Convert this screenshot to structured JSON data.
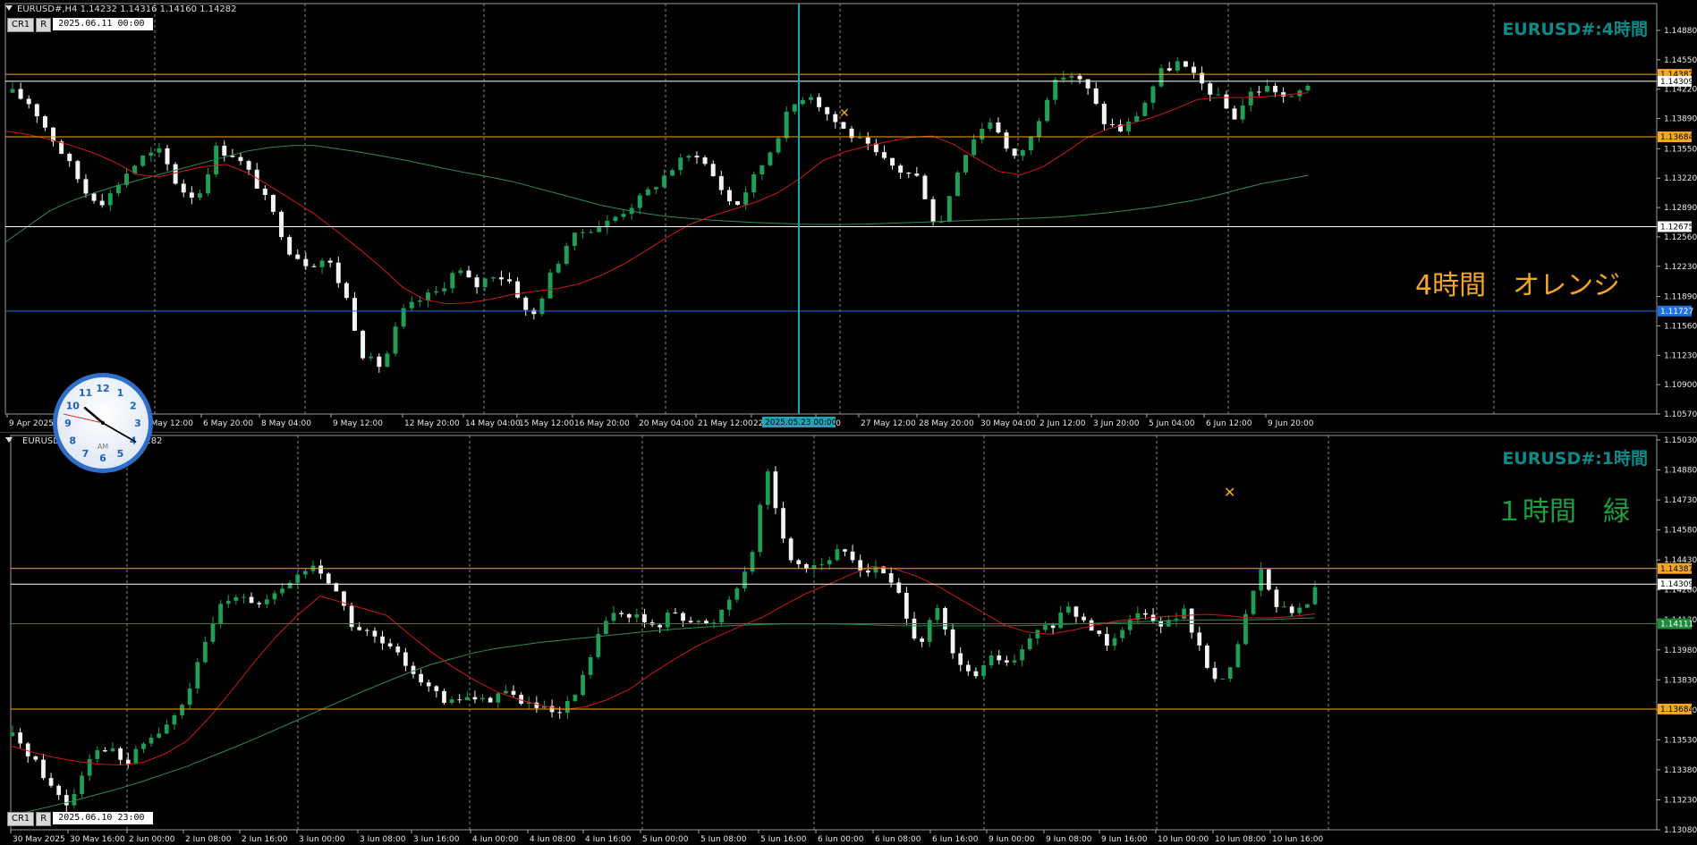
{
  "top_chart": {
    "header": "EURUSD#,H4  1.14232 1.14316 1.14160 1.14282",
    "ctrl_cr": "CR1",
    "ctrl_r": "R",
    "ctrl_date": "2025.06.11 00:00",
    "title": "EURUSD#:4時間",
    "note": "4時間　オレンジ",
    "note_color": "#f5a623",
    "y_ticks": [
      "1.14880",
      "1.14550",
      "1.14220",
      "1.13890",
      "1.13550",
      "1.13220",
      "1.12890",
      "1.12560",
      "1.12230",
      "1.11890",
      "1.11560",
      "1.11230",
      "1.10900",
      "1.10570"
    ],
    "x_ticks": [
      "9 Apr 2025",
      "5 May 12:00",
      "6 May 20:00",
      "8 May 04:00",
      "9 May 12:00",
      "12 May 20:00",
      "14 May 04:00",
      "15 May 12:00",
      "16 May 20:00",
      "20 May 04:00",
      "21 May 12:00",
      "22 M",
      "04:00",
      "27 May 12:00",
      "28 May 20:00",
      "30 May 04:00",
      "2 Jun 12:00",
      "3 Jun 20:00",
      "5 Jun 04:00",
      "6 Jun 12:00",
      "9 Jun 20:00"
    ],
    "x_ticks_partial": [
      "00"
    ],
    "crosshair_label": "2025.05.23 00:00",
    "price_lines": [
      {
        "label": "1.14387",
        "color": "#f5a623"
      },
      {
        "label": "1.14309",
        "color": "#ffffff"
      },
      {
        "label": "1.13684",
        "color": "#f5a623"
      },
      {
        "label": "1.12675",
        "color": "#ffffff"
      },
      {
        "label": "1.11727",
        "color": "#1e6fe0"
      }
    ]
  },
  "bottom_chart": {
    "header": "EURUSD#,H1  1.14185 1.14282",
    "ctrl_cr": "CR1",
    "ctrl_r": "R",
    "ctrl_date": "2025.06.10 23:00",
    "title": "EURUSD#:1時間",
    "note": "１時間　緑",
    "note_color": "#1aa33a",
    "y_ticks": [
      "1.15030",
      "1.14880",
      "1.14730",
      "1.14580",
      "1.14430",
      "1.14280",
      "1.14130",
      "1.13980",
      "1.13830",
      "1.13680",
      "1.13530",
      "1.13380",
      "1.13230",
      "1.13080"
    ],
    "x_ticks": [
      "30 May 2025",
      "30 May 16:00",
      "2 Jun 00:00",
      "2 Jun 08:00",
      "2 Jun 16:00",
      "3 Jun 00:00",
      "3 Jun 08:00",
      "3 Jun 16:00",
      "4 Jun 00:00",
      "4 Jun 08:00",
      "4 Jun 16:00",
      "5 Jun 00:00",
      "5 Jun 08:00",
      "5 Jun 16:00",
      "6 Jun 00:00",
      "6 Jun 08:00",
      "6 Jun 16:00",
      "9 Jun 00:00",
      "9 Jun 08:00",
      "9 Jun 16:00",
      "10 Jun 00:00",
      "10 Jun 08:00",
      "10 Jun 16:00"
    ],
    "price_lines": [
      {
        "label": "1.14387",
        "color": "#f5a623"
      },
      {
        "label": "1.14309",
        "color": "#ffffff"
      },
      {
        "label": "1.14111",
        "color": "#1f8a3a"
      },
      {
        "label": "1.13684",
        "color": "#f5a623"
      }
    ]
  },
  "clock": {
    "numbers": [
      "12",
      "1",
      "2",
      "3",
      "4",
      "5",
      "6",
      "7",
      "8",
      "9",
      "10",
      "11"
    ],
    "ampm": "AM",
    "time": "10:20"
  },
  "chart_data": [
    {
      "type": "candlestick",
      "title": "EURUSD#:4時間",
      "timeframe": "H4",
      "ylim": [
        1.1057,
        1.1488
      ],
      "approx_close_path": [
        1.1418,
        1.1405,
        1.1372,
        1.134,
        1.1305,
        1.1295,
        1.1325,
        1.1345,
        1.1352,
        1.131,
        1.13,
        1.1355,
        1.1348,
        1.1322,
        1.1285,
        1.124,
        1.1225,
        1.1232,
        1.119,
        1.112,
        1.111,
        1.117,
        1.1185,
        1.1195,
        1.122,
        1.12,
        1.1215,
        1.1205,
        1.116,
        1.121,
        1.125,
        1.1265,
        1.127,
        1.1285,
        1.13,
        1.132,
        1.134,
        1.135,
        1.132,
        1.1288,
        1.132,
        1.1355,
        1.14,
        1.142,
        1.1395,
        1.1375,
        1.136,
        1.1342,
        1.133,
        1.1322,
        1.126,
        1.133,
        1.137,
        1.139,
        1.134,
        1.1365,
        1.142,
        1.1442,
        1.1425,
        1.1385,
        1.1375,
        1.14,
        1.144,
        1.1452,
        1.1432,
        1.1415,
        1.139,
        1.142,
        1.1425,
        1.1408,
        1.1428
      ],
      "ma_red_path": [
        1.1375,
        1.137,
        1.1362,
        1.1352,
        1.1338,
        1.132,
        1.1328,
        1.1335,
        1.1338,
        1.132,
        1.13,
        1.128,
        1.1255,
        1.123,
        1.12,
        1.1182,
        1.118,
        1.1185,
        1.1192,
        1.1196,
        1.12,
        1.1212,
        1.1228,
        1.1248,
        1.1268,
        1.128,
        1.129,
        1.13,
        1.132,
        1.1345,
        1.1355,
        1.1362,
        1.1368,
        1.137,
        1.135,
        1.133,
        1.1325,
        1.134,
        1.1365,
        1.1378,
        1.1385,
        1.1395,
        1.141,
        1.1413,
        1.1412,
        1.1415,
        1.1418
      ],
      "ma_green_path": [
        1.125,
        1.129,
        1.131,
        1.1325,
        1.134,
        1.1355,
        1.136,
        1.1352,
        1.1342,
        1.133,
        1.132,
        1.1305,
        1.129,
        1.128,
        1.1275,
        1.1272,
        1.127,
        1.127,
        1.1272,
        1.1274,
        1.1276,
        1.1278,
        1.1283,
        1.129,
        1.13,
        1.1315,
        1.1325
      ],
      "horizontal_lines": [
        1.14387,
        1.14309,
        1.13684,
        1.12675,
        1.11727
      ]
    },
    {
      "type": "candlestick",
      "title": "EURUSD#:1時間",
      "timeframe": "H1",
      "ylim": [
        1.1308,
        1.1503
      ],
      "approx_close_path": [
        1.1355,
        1.1345,
        1.133,
        1.132,
        1.1345,
        1.135,
        1.134,
        1.1352,
        1.1358,
        1.137,
        1.1395,
        1.142,
        1.1428,
        1.142,
        1.1425,
        1.1435,
        1.144,
        1.143,
        1.141,
        1.1405,
        1.1398,
        1.139,
        1.138,
        1.137,
        1.1375,
        1.1372,
        1.1378,
        1.1372,
        1.1368,
        1.1365,
        1.1378,
        1.1405,
        1.1418,
        1.1415,
        1.1408,
        1.1418,
        1.1412,
        1.141,
        1.1425,
        1.144,
        1.1488,
        1.1445,
        1.144,
        1.1442,
        1.1448,
        1.1438,
        1.1438,
        1.1425,
        1.14,
        1.1418,
        1.139,
        1.1385,
        1.1395,
        1.139,
        1.1405,
        1.141,
        1.1418,
        1.141,
        1.1402,
        1.1412,
        1.1418,
        1.141,
        1.1418,
        1.1395,
        1.138,
        1.1402,
        1.144,
        1.142,
        1.1415,
        1.1428
      ],
      "ma_red_path": [
        1.135,
        1.1345,
        1.1342,
        1.134,
        1.1342,
        1.135,
        1.1368,
        1.139,
        1.141,
        1.1425,
        1.142,
        1.1415,
        1.14,
        1.1388,
        1.1378,
        1.1372,
        1.1368,
        1.137,
        1.1378,
        1.139,
        1.14,
        1.1408,
        1.1415,
        1.1425,
        1.1432,
        1.144,
        1.1438,
        1.143,
        1.142,
        1.141,
        1.1405,
        1.1408,
        1.1412,
        1.1414,
        1.1415,
        1.1416,
        1.1414,
        1.1414,
        1.1416
      ],
      "ma_green_path": [
        1.1315,
        1.1322,
        1.133,
        1.134,
        1.1352,
        1.1365,
        1.1378,
        1.139,
        1.1398,
        1.1402,
        1.1405,
        1.1408,
        1.141,
        1.1411,
        1.1411,
        1.141,
        1.141,
        1.141,
        1.1411,
        1.1412,
        1.1413,
        1.1413,
        1.1414
      ],
      "horizontal_lines": [
        1.14387,
        1.14309,
        1.14111,
        1.13684
      ]
    }
  ]
}
